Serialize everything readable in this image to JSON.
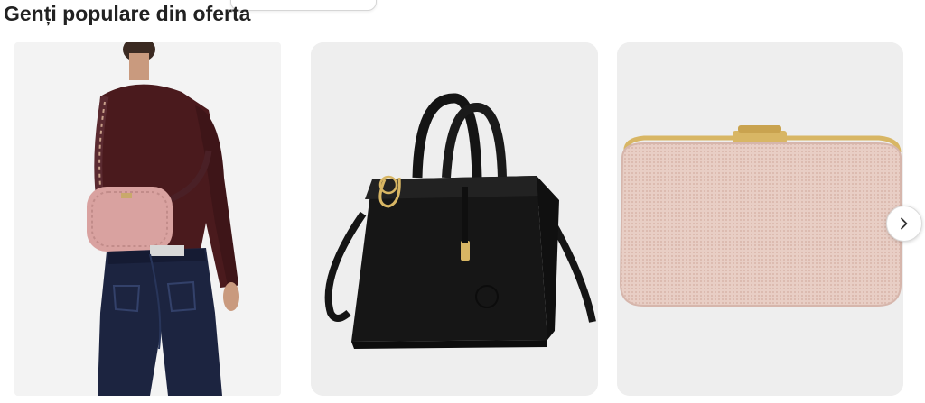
{
  "section": {
    "title": "Genți populare din oferta"
  },
  "carousel": {
    "products": [
      {
        "image": "woman-with-pink-quilted-crossbody-bag"
      },
      {
        "image": "black-leather-tote-handbag"
      },
      {
        "image": "pink-glitter-clutch"
      }
    ],
    "next_icon": "chevron-right-icon"
  },
  "colors": {
    "title": "#222222",
    "card_background": "#efefef",
    "pink_bag": "#d9a2a0",
    "black_bag": "#161616",
    "clutch": "#e9cfc6",
    "gold_clasp": "#d8b664"
  }
}
